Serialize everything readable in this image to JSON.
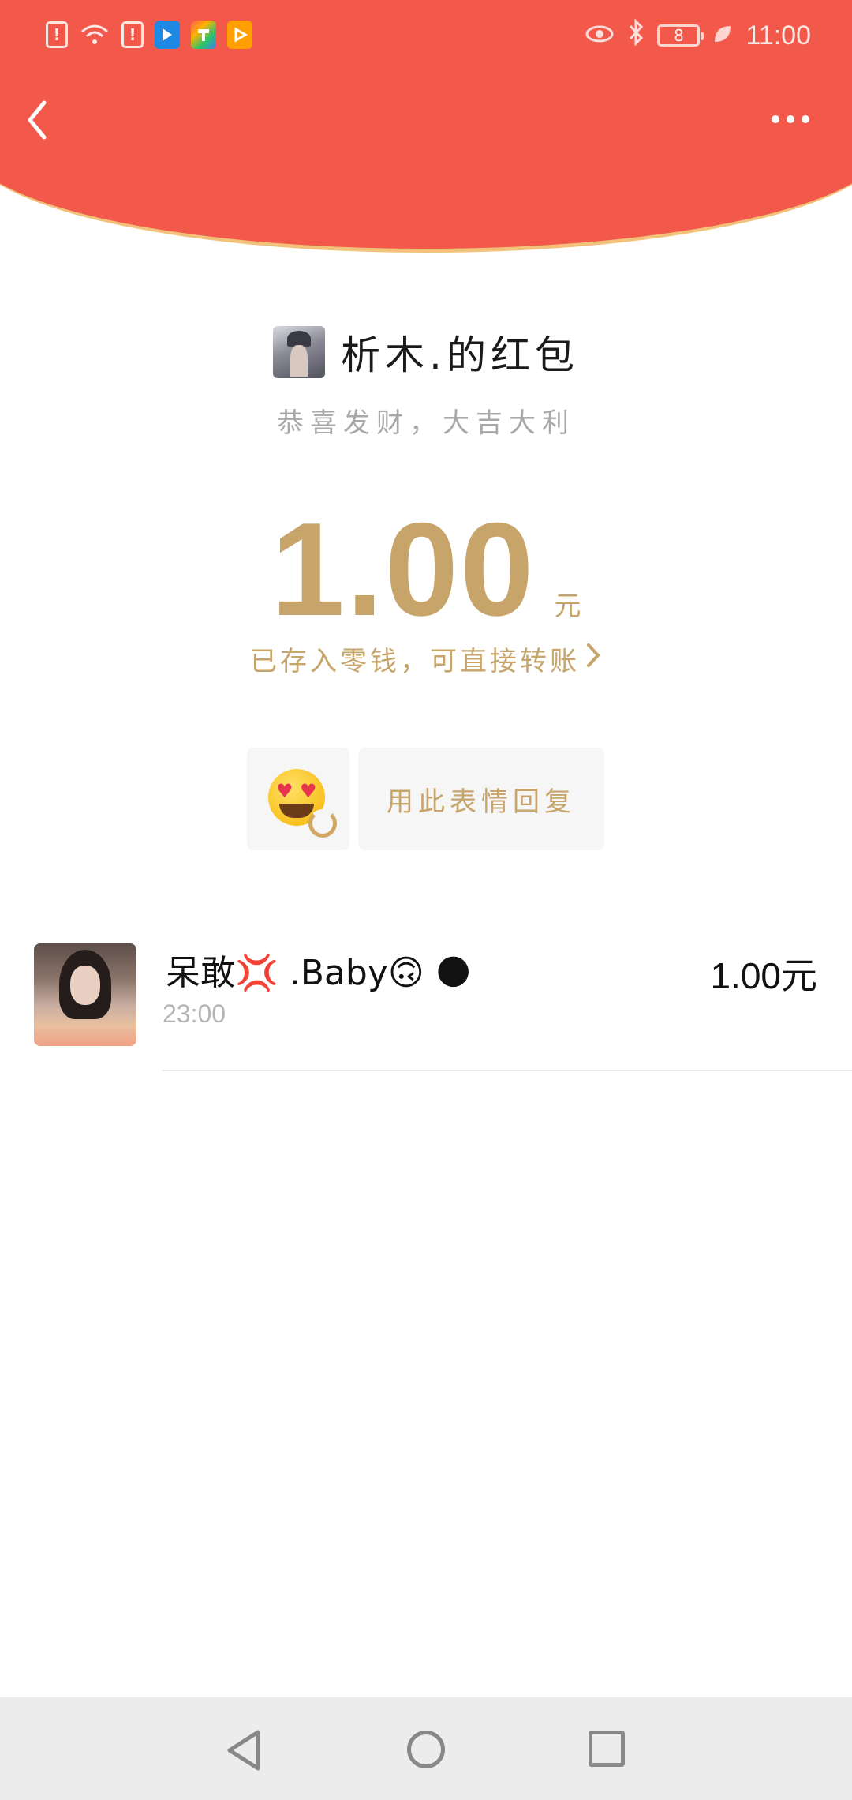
{
  "status_bar": {
    "battery": "8",
    "time": "11:00"
  },
  "envelope": {
    "sender_title": "析木.的红包",
    "wish": "恭喜发财，大吉大利",
    "amount": "1.00",
    "unit": "元",
    "deposit_text": "已存入零钱，可直接转账"
  },
  "reply": {
    "label": "用此表情回复"
  },
  "receivers": [
    {
      "name": "呆敢💢 .Baby🙃 🌑",
      "time": "23:00",
      "amount": "1.00元"
    }
  ],
  "colors": {
    "header_red": "#f2594a",
    "gold": "#c6a46a"
  }
}
